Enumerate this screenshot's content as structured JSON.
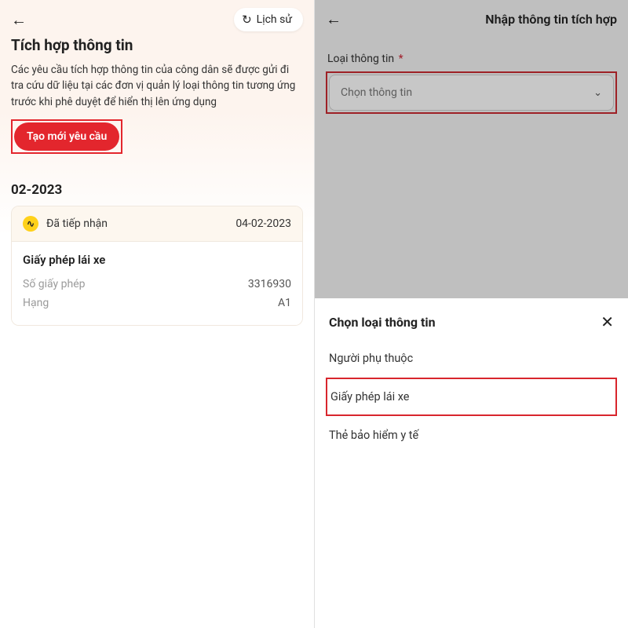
{
  "left": {
    "history_label": "Lịch sử",
    "title": "Tích hợp thông tin",
    "description": "Các yêu cầu tích hợp thông tin của công dân sẽ được gửi đi tra cứu dữ liệu tại các đơn vị quản lý loại thông tin tương ứng trước khi phê duyệt để hiển thị lên ứng dụng",
    "create_button": "Tạo mới yêu cầu",
    "month": "02-2023",
    "card": {
      "status": "Đã tiếp nhận",
      "date": "04-02-2023",
      "doc_title": "Giấy phép lái xe",
      "rows": [
        {
          "label": "Số giấy phép",
          "value": "3316930"
        },
        {
          "label": "Hạng",
          "value": "A1"
        }
      ]
    }
  },
  "right": {
    "title": "Nhập thông tin tích hợp",
    "field_label": "Loại thông tin",
    "required_mark": "*",
    "dropdown_placeholder": "Chọn thông tin",
    "sheet": {
      "title": "Chọn loại thông tin",
      "items": [
        "Người phụ thuộc",
        "Giấy phép lái xe",
        "Thẻ bảo hiểm y tế"
      ]
    }
  }
}
